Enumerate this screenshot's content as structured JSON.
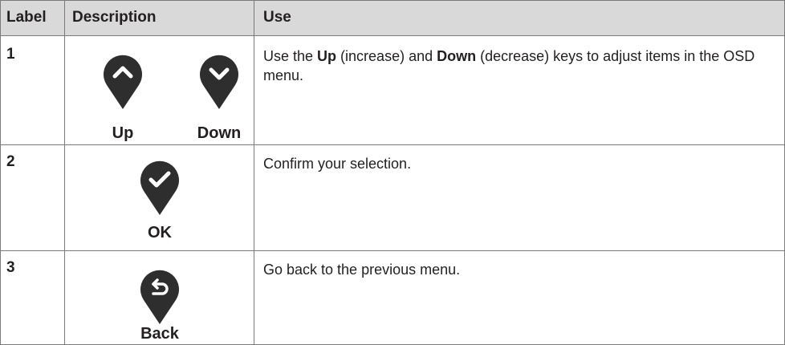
{
  "header": {
    "label": "Label",
    "description": "Description",
    "use": "Use"
  },
  "rows": [
    {
      "label": "1",
      "buttons": [
        {
          "name": "Up",
          "icon": "chevron-up-icon"
        },
        {
          "name": "Down",
          "icon": "chevron-down-icon"
        }
      ],
      "use_parts": [
        "Use the ",
        "Up",
        " (increase) and ",
        "Down",
        " (decrease) keys to adjust items in the OSD menu."
      ]
    },
    {
      "label": "2",
      "buttons": [
        {
          "name": "OK",
          "icon": "checkmark-icon"
        }
      ],
      "use_text": "Confirm your selection."
    },
    {
      "label": "3",
      "buttons": [
        {
          "name": "Back",
          "icon": "back-arrow-icon"
        }
      ],
      "use_text": "Go back to the previous menu."
    }
  ],
  "colors": {
    "header_bg": "#d9d9d9",
    "pin": "#2e2e2e",
    "border": "#7a7a7a"
  }
}
